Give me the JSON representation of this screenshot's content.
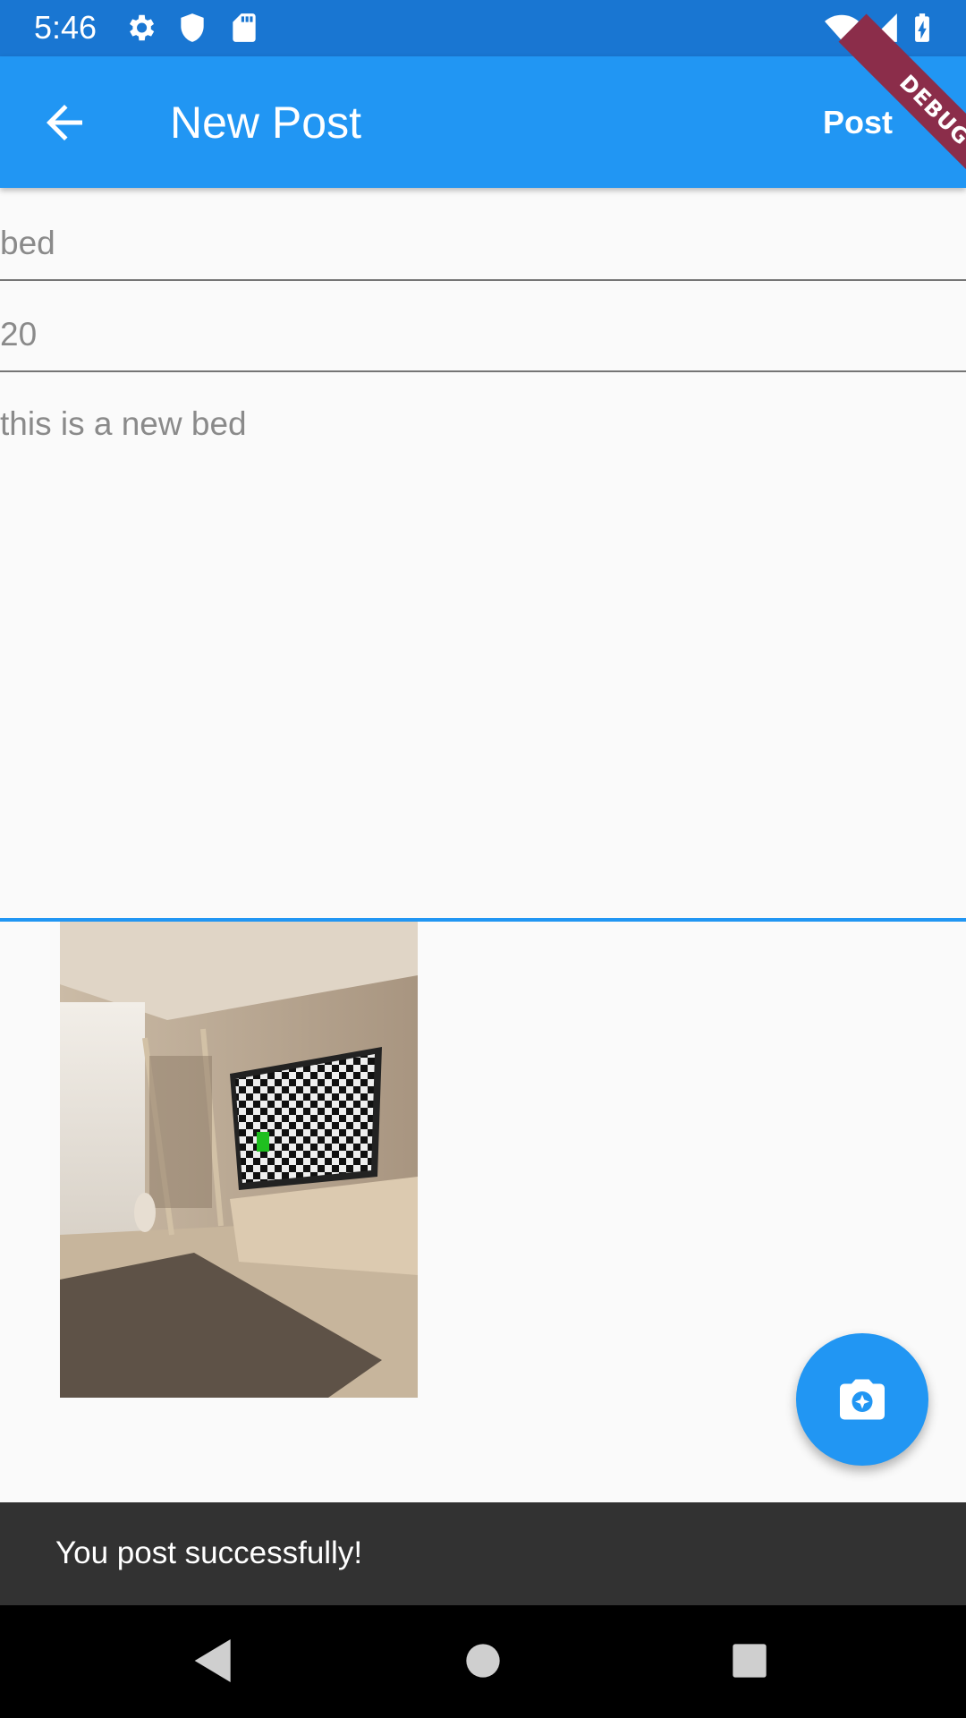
{
  "status_bar": {
    "time": "5:46",
    "icons": [
      "gear-icon",
      "shield-icon",
      "sd-card-icon",
      "wifi-icon",
      "signal-icon",
      "battery-charging-icon"
    ]
  },
  "app_bar": {
    "title": "New Post",
    "action_label": "Post",
    "back_icon": "arrow-back-icon",
    "debug_label": "DEBUG",
    "color": "#2196f3"
  },
  "form": {
    "title_value": "bed",
    "price_value": "20",
    "description_value": "this is a new bed"
  },
  "fab": {
    "icon": "camera-icon"
  },
  "snackbar": {
    "message": "You post successfully!"
  },
  "nav_bar": {
    "icons": [
      "back-triangle-icon",
      "home-circle-icon",
      "recents-square-icon"
    ]
  }
}
